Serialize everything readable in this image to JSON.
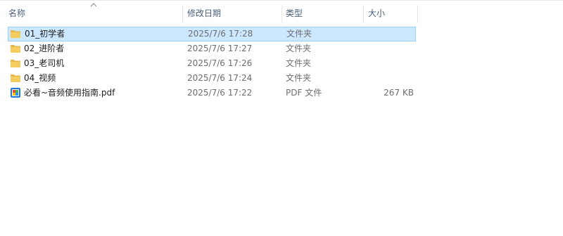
{
  "columns": {
    "name": "名称",
    "date": "修改日期",
    "type": "类型",
    "size": "大小"
  },
  "files": [
    {
      "name": "01_初学者",
      "date": "2025/7/6 17:28",
      "type": "文件夹",
      "size": "",
      "icon": "folder-icon",
      "selected": true
    },
    {
      "name": "02_进阶者",
      "date": "2025/7/6 17:27",
      "type": "文件夹",
      "size": "",
      "icon": "folder-icon",
      "selected": false
    },
    {
      "name": "03_老司机",
      "date": "2025/7/6 17:26",
      "type": "文件夹",
      "size": "",
      "icon": "folder-icon",
      "selected": false
    },
    {
      "name": "04_视频",
      "date": "2025/7/6 17:24",
      "type": "文件夹",
      "size": "",
      "icon": "folder-icon",
      "selected": false
    },
    {
      "name": "必看~音频使用指南.pdf",
      "date": "2025/7/6 17:22",
      "type": "PDF 文件",
      "size": "267 KB",
      "icon": "pdf-file-icon",
      "selected": false
    }
  ],
  "colors": {
    "selection_bg": "#cce8ff",
    "selection_border": "#99d1ff",
    "folder": "#e8b84a",
    "header_text": "#4c607a"
  }
}
